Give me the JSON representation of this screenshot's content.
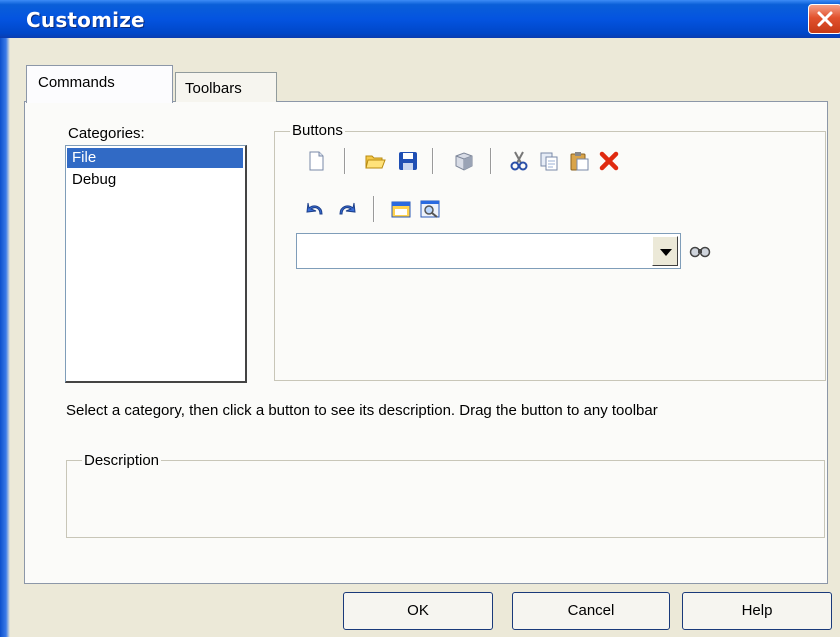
{
  "window": {
    "title": "Customize"
  },
  "tabs": [
    {
      "label": "Commands"
    },
    {
      "label": "Toolbars"
    }
  ],
  "categories": {
    "label": "Categories:",
    "items": [
      {
        "label": "File",
        "selected": true
      },
      {
        "label": "Debug",
        "selected": false
      }
    ]
  },
  "buttons_group": {
    "label": "Buttons",
    "icons": [
      "new-icon",
      "open-folder-icon",
      "save-icon",
      "cube-icon",
      "cut-icon",
      "copy-icon",
      "paste-icon",
      "delete-icon",
      "undo-icon",
      "redo-icon",
      "window-icon",
      "find-icon"
    ],
    "combo_value": ""
  },
  "help_text": "Select a category, then click a button to see its description. Drag the button to any toolbar",
  "description": {
    "label": "Description",
    "value": ""
  },
  "actions": {
    "ok": "OK",
    "cancel": "Cancel",
    "help": "Help"
  },
  "colors": {
    "title_bar": "#0454E0",
    "selection": "#316AC5",
    "dialog_bg": "#ECE9D8",
    "close_button": "#E2522E"
  }
}
